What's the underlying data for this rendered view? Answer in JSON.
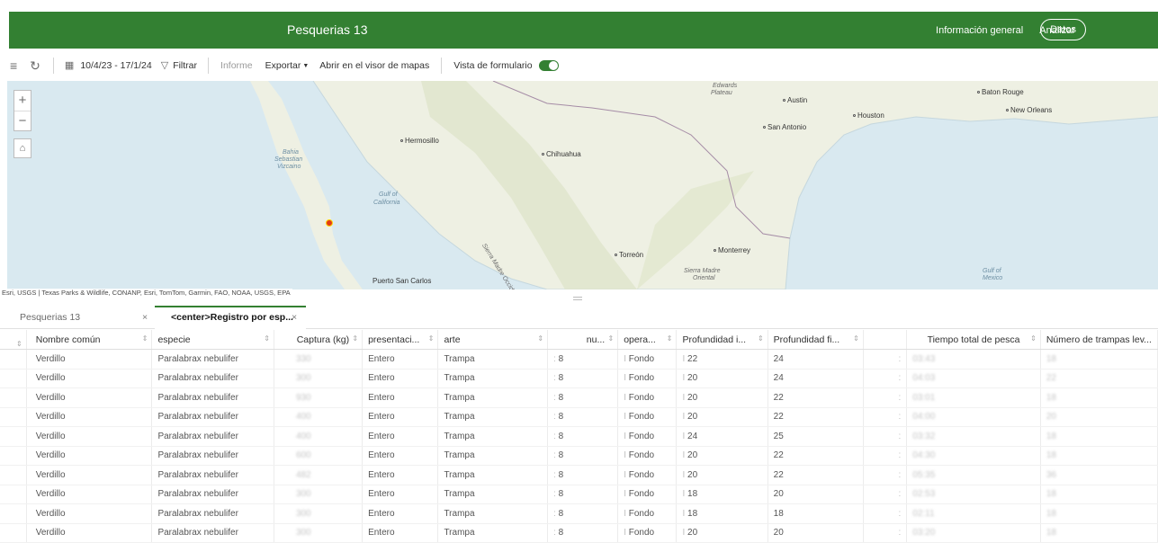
{
  "header": {
    "title": "Pesquerias 13",
    "nav": [
      "Información general",
      "Analizar"
    ],
    "active_nav": "Datos",
    "color": "#338032"
  },
  "toolbar": {
    "menu_icon": "hamburger-icon",
    "refresh_icon": "refresh-icon",
    "calendar_icon": "calendar-icon",
    "date_range": "10/4/23 - 17/1/24",
    "filter_icon": "filter-icon",
    "filter_label": "Filtrar",
    "report_label": "Informe",
    "export_label": "Exportar",
    "open_map_label": "Abrir en el visor de mapas",
    "form_view_label": "Vista de formulario",
    "form_view_on": true
  },
  "map": {
    "attribution": "Esri, USGS | Texas Parks & Wildlife, CONANP, Esri, TomTom, Garmin, FAO, NOAA, USGS, EPA",
    "zoom_in": "+",
    "zoom_out": "−",
    "labels": {
      "edwards": "Edwards",
      "plateau": "Plateau",
      "austin": "Austin",
      "san_antonio": "San Antonio",
      "houston": "Houston",
      "baton_rouge": "Baton Rouge",
      "new_orleans": "New Orleans",
      "hermosillo": "Hermosillo",
      "chihuahua": "Chihuahua",
      "bahia1": "Bahia",
      "bahia2": "Sebastian",
      "bahia3": "Vizcaino",
      "gulf_cal1": "Gulf of",
      "gulf_cal2": "California",
      "sierra_occ": "Sierra Madre Occidental",
      "torreon": "Torreón",
      "monterrey": "Monterrey",
      "sierra_or1": "Sierra Madre",
      "sierra_or2": "Oriental",
      "gulf_mex1": "Gulf of",
      "gulf_mex2": "Mexico",
      "puerto": "Puerto San Carlos"
    }
  },
  "tabs": [
    {
      "label": "Pesquerias 13",
      "close": "×"
    },
    {
      "label": "<center>Registro por esp...",
      "close": "×"
    }
  ],
  "table": {
    "columns": [
      "Nombre común",
      "especie",
      "Captura (kg)",
      "presentaci...",
      "arte",
      "nu...",
      "opera...",
      "Profundidad i...",
      "Profundidad fi...",
      "",
      "Tiempo total de pesca",
      "Número de trampas lev..."
    ],
    "rows": [
      [
        "Verdillo",
        "Paralabrax nebulifer",
        "330",
        "Entero",
        "Trampa",
        "8",
        "Fondo",
        "22",
        "24",
        "",
        "03:43",
        "18"
      ],
      [
        "Verdillo",
        "Paralabrax nebulifer",
        "300",
        "Entero",
        "Trampa",
        "8",
        "Fondo",
        "20",
        "24",
        "",
        "04:03",
        "22"
      ],
      [
        "Verdillo",
        "Paralabrax nebulifer",
        "930",
        "Entero",
        "Trampa",
        "8",
        "Fondo",
        "20",
        "22",
        "",
        "03:01",
        "18"
      ],
      [
        "Verdillo",
        "Paralabrax nebulifer",
        "400",
        "Entero",
        "Trampa",
        "8",
        "Fondo",
        "20",
        "22",
        "",
        "04:00",
        "20"
      ],
      [
        "Verdillo",
        "Paralabrax nebulifer",
        "400",
        "Entero",
        "Trampa",
        "8",
        "Fondo",
        "24",
        "25",
        "",
        "03:32",
        "18"
      ],
      [
        "Verdillo",
        "Paralabrax nebulifer",
        "600",
        "Entero",
        "Trampa",
        "8",
        "Fondo",
        "20",
        "22",
        "",
        "04:30",
        "18"
      ],
      [
        "Verdillo",
        "Paralabrax nebulifer",
        "482",
        "Entero",
        "Trampa",
        "8",
        "Fondo",
        "20",
        "22",
        "",
        "05:35",
        "36"
      ],
      [
        "Verdillo",
        "Paralabrax nebulifer",
        "300",
        "Entero",
        "Trampa",
        "8",
        "Fondo",
        "18",
        "20",
        "",
        "02:53",
        "18"
      ],
      [
        "Verdillo",
        "Paralabrax nebulifer",
        "300",
        "Entero",
        "Trampa",
        "8",
        "Fondo",
        "18",
        "18",
        "",
        "02:11",
        "18"
      ],
      [
        "Verdillo",
        "Paralabrax nebulifer",
        "300",
        "Entero",
        "Trampa",
        "8",
        "Fondo",
        "20",
        "20",
        "",
        "03:20",
        "18"
      ]
    ]
  }
}
